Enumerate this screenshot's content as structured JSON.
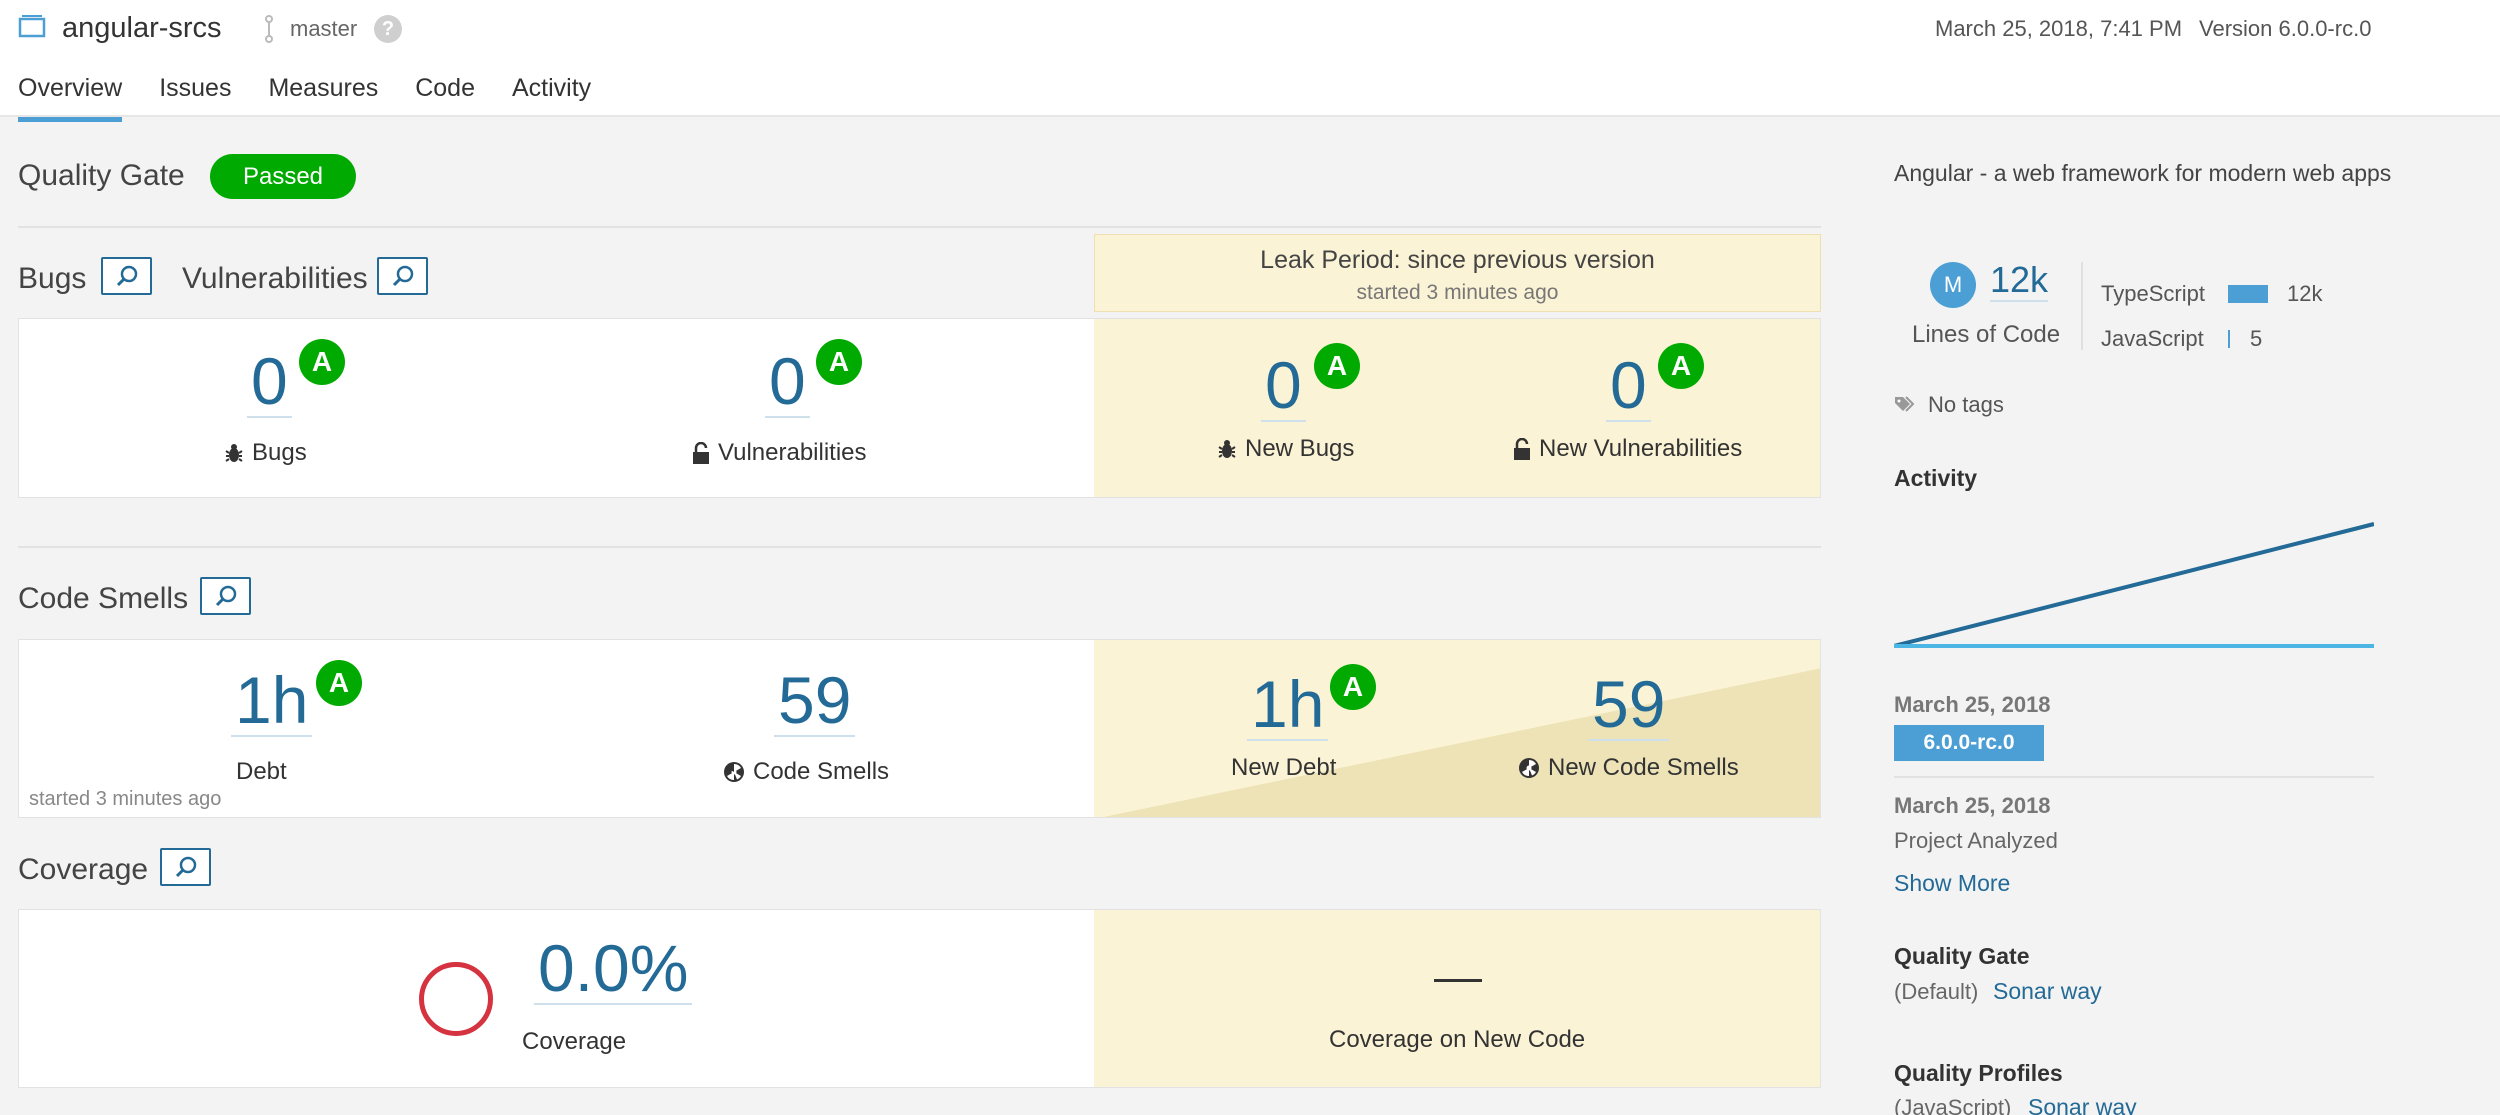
{
  "header": {
    "project_name": "angular-srcs",
    "branch": "master",
    "help_icon": "help-icon",
    "analysis_date": "March 25, 2018, 7:41 PM",
    "version": "Version 6.0.0-rc.0",
    "nav": [
      "Overview",
      "Issues",
      "Measures",
      "Code",
      "Activity"
    ],
    "active_tab": "Overview"
  },
  "quality_gate": {
    "title": "Quality Gate",
    "status": "Passed",
    "status_color": "#00aa00"
  },
  "leak_period": {
    "title": "Leak Period: since previous version",
    "subtitle": "started 3 minutes ago"
  },
  "reliability": {
    "bugs_title": "Bugs",
    "vulns_title": "Vulnerabilities",
    "bugs": {
      "value": "0",
      "rating": "A",
      "label": "Bugs",
      "icon": "bug-icon"
    },
    "vulnerabilities": {
      "value": "0",
      "rating": "A",
      "label": "Vulnerabilities",
      "icon": "lock-icon"
    },
    "new_bugs": {
      "value": "0",
      "rating": "A",
      "label": "New Bugs",
      "icon": "bug-icon"
    },
    "new_vulnerabilities": {
      "value": "0",
      "rating": "A",
      "label": "New Vulnerabilities",
      "icon": "lock-icon"
    }
  },
  "maintainability": {
    "title": "Code Smells",
    "debt": {
      "value": "1h",
      "rating": "A",
      "label": "Debt"
    },
    "code_smells": {
      "value": "59",
      "label": "Code Smells",
      "icon": "radiation-icon"
    },
    "new_debt": {
      "value": "1h",
      "rating": "A",
      "label": "New Debt"
    },
    "new_code_smells": {
      "value": "59",
      "label": "New Code Smells",
      "icon": "radiation-icon"
    },
    "note": "started 3 minutes ago"
  },
  "coverage": {
    "title": "Coverage",
    "value": "0.0%",
    "label": "Coverage",
    "new_value": "—",
    "new_label": "Coverage on New Code"
  },
  "sidebar": {
    "description": "Angular - a web framework for modern web apps",
    "avatar_letter": "M",
    "lines_of_code": "12k",
    "lines_of_code_label": "Lines of Code",
    "languages": [
      {
        "name": "TypeScript",
        "value": "12k",
        "share": 0.9996
      },
      {
        "name": "JavaScript",
        "value": "5",
        "share": 0.0004
      }
    ],
    "tags": "No tags",
    "activity_title": "Activity",
    "activity_chart": {
      "series": [
        {
          "values": [
            0,
            12000
          ],
          "color": "#236a97"
        },
        {
          "values": [
            0,
            0
          ],
          "color": "#4bb6e3"
        }
      ]
    },
    "events": [
      {
        "date": "March 25, 2018",
        "badge": "6.0.0-rc.0"
      },
      {
        "date": "March 25, 2018",
        "text": "Project Analyzed"
      }
    ],
    "show_more": "Show More",
    "quality_gate_title": "Quality Gate",
    "quality_gate_default": "(Default)",
    "quality_gate_link": "Sonar way",
    "quality_profiles_title": "Quality Profiles",
    "quality_profiles_lang": "(JavaScript)",
    "quality_profiles_link": "Sonar way"
  }
}
